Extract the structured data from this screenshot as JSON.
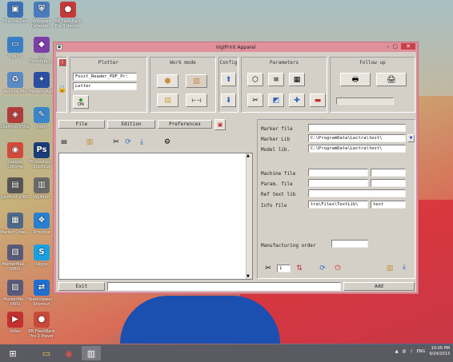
{
  "desktop": {
    "icons": [
      {
        "label": "This Hải Dev",
        "glyph": "▣",
        "color": "#3c6fb5"
      },
      {
        "label": "Windows Defende...",
        "glyph": "⛨",
        "color": "#4a7bbd"
      },
      {
        "label": "BB FlashBack Pro 3 Recor...",
        "glyph": "●",
        "color": "#c53a3a"
      },
      {
        "label": "This PC",
        "glyph": "▭",
        "color": "#3a7fc6"
      },
      {
        "label": "3D Prototypin...",
        "glyph": "◆",
        "color": "#7d3ea8"
      },
      {
        "label": "Recycle Bin",
        "glyph": "♻",
        "color": "#5b8ac4"
      },
      {
        "label": "ModelsVAR1",
        "glyph": "✦",
        "color": "#2a4fa0"
      },
      {
        "label": "Diamino V5R2",
        "glyph": "◈",
        "color": "#b23c3c"
      },
      {
        "label": "Paint",
        "glyph": "✎",
        "color": "#3a86c8"
      },
      {
        "label": "Google Chrome",
        "glyph": "◉",
        "color": "#d24a3a"
      },
      {
        "label": "Photoshop - Shortcut",
        "glyph": "Ps",
        "color": "#1a3d7a"
      },
      {
        "label": "JustPrint V3R2",
        "glyph": "▤",
        "color": "#555555"
      },
      {
        "label": "VigiPrint",
        "glyph": "▥",
        "color": "#6a6a6a"
      },
      {
        "label": "Marker Creat...",
        "glyph": "▦",
        "color": "#4d6a8a"
      },
      {
        "label": "Dropbox",
        "glyph": "❖",
        "color": "#2a7fd0"
      },
      {
        "label": "MarkerMak... V8R1",
        "glyph": "▧",
        "color": "#5a5a7a"
      },
      {
        "label": "Skype",
        "glyph": "S",
        "color": "#1aa0e0"
      },
      {
        "label": "MarkerMa... V8R1",
        "glyph": "▨",
        "color": "#5a5a7a"
      },
      {
        "label": "TeamViewer - Shortcut",
        "glyph": "⇄",
        "color": "#1f6fd0"
      },
      {
        "label": "Video",
        "glyph": "▶",
        "color": "#c23030"
      },
      {
        "label": "BB FlashBack Pro 3 Player",
        "glyph": "●",
        "color": "#c54a3a"
      }
    ]
  },
  "window": {
    "title": "VigiPrint Apparel",
    "tabs": {
      "plotter": "Plotter",
      "work_mode": "Work mode",
      "config": "Config",
      "parameters": "Parameters",
      "follow_up": "Follow up"
    },
    "plotter_name": "Foxit_Reader_PDF_Pr:",
    "paper": "Letter",
    "on_label": "ON",
    "menu": {
      "file": "File",
      "edition": "Edition",
      "preferences": "Preferences"
    },
    "form": {
      "marker_file_label": "Marker file",
      "marker_file": "",
      "marker_lib_label": "Marker Lib",
      "marker_lib": "C:\\ProgramData\\Lectra\\test\\",
      "model_lib_label": "Model lib.",
      "model_lib": "C:\\ProgramData\\Lectra\\test\\",
      "machine_file_label": "Machine file",
      "param_file_label": "Param. file",
      "ref_text_lib_label": "Ref text lib",
      "info_file_label": "Info file",
      "info_file": "tra\\Files\\TextLib\\",
      "info_file_ext": "text",
      "manufacturing_order_label": "Manufacturing order",
      "copies": "1"
    },
    "exit_label": "Exit",
    "add_label": "Add"
  },
  "taskbar": {
    "lang": "ENG",
    "time": "10:05 PM",
    "date": "9/24/2013"
  }
}
